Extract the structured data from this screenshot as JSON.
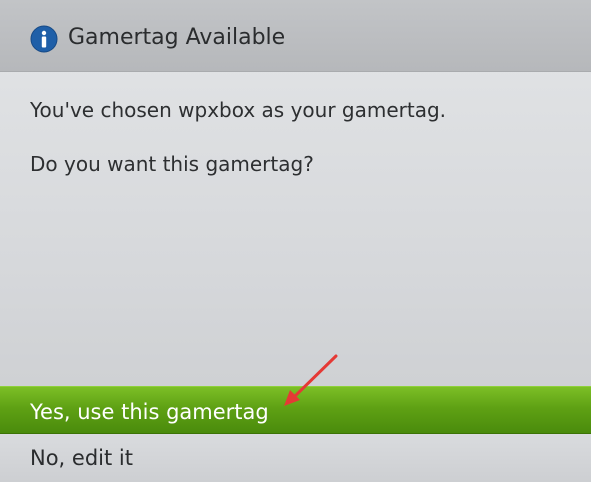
{
  "dialog": {
    "title": "Gamertag Available",
    "title_icon": "info-icon",
    "message_line1": "You've chosen wpxbox as your gamertag.",
    "message_line2": "Do you want this gamertag?"
  },
  "options": {
    "yes_label": "Yes, use this gamertag",
    "no_label": "No, edit it"
  },
  "colors": {
    "accent_green": "#5fa114",
    "annotation_arrow": "#e53935",
    "info_icon_blue": "#1f5fa8"
  }
}
